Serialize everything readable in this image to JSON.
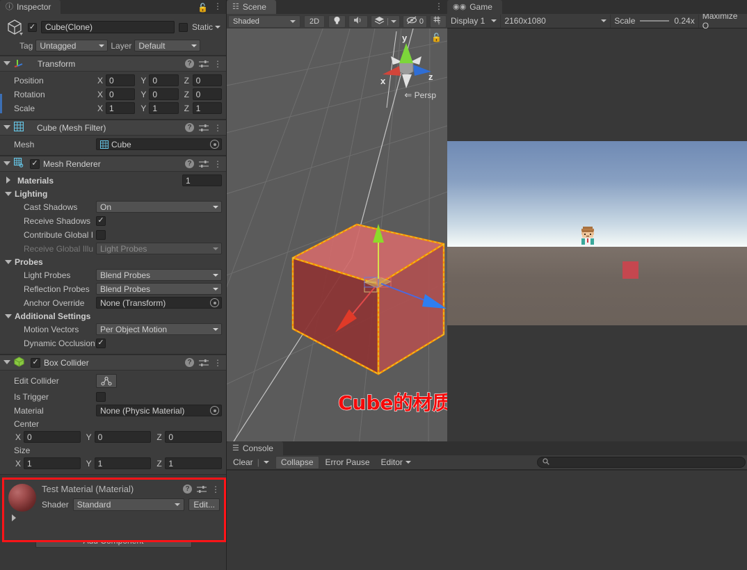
{
  "inspector": {
    "tab_label": "Inspector",
    "tab_icon": "info-icon",
    "lock_icon": "lock-icon",
    "menu_icon": "kebab-menu-icon",
    "object": {
      "enabled": true,
      "name": "Cube(Clone)",
      "static_label": "Static",
      "static_checked": false,
      "tag_label": "Tag",
      "tag_value": "Untagged",
      "layer_label": "Layer",
      "layer_value": "Default"
    },
    "components": [
      {
        "title": "Transform",
        "icon": "transform-axes-icon",
        "expanded": true,
        "rows": [
          {
            "label": "Position",
            "x": "0",
            "y": "0",
            "z": "0"
          },
          {
            "label": "Rotation",
            "x": "0",
            "y": "0",
            "z": "0"
          },
          {
            "label": "Scale",
            "x": "1",
            "y": "1",
            "z": "1"
          }
        ]
      },
      {
        "title": "Cube (Mesh Filter)",
        "icon": "mesh-filter-icon",
        "expanded": true,
        "mesh_label": "Mesh",
        "mesh_value": "Cube"
      },
      {
        "title": "Mesh Renderer",
        "icon": "mesh-renderer-icon",
        "expanded": true,
        "enabled": true,
        "materials_label": "Materials",
        "materials_count": "1",
        "lighting_label": "Lighting",
        "cast_shadows_label": "Cast Shadows",
        "cast_shadows_value": "On",
        "receive_shadows_label": "Receive Shadows",
        "receive_shadows_checked": true,
        "contribute_gi_label": "Contribute Global I",
        "contribute_gi_checked": false,
        "receive_gi_label": "Receive Global Illu",
        "receive_gi_value": "Light Probes",
        "probes_label": "Probes",
        "light_probes_label": "Light Probes",
        "light_probes_value": "Blend Probes",
        "reflection_probes_label": "Reflection Probes",
        "reflection_probes_value": "Blend Probes",
        "anchor_override_label": "Anchor Override",
        "anchor_override_value": "None (Transform)",
        "additional_settings_label": "Additional Settings",
        "motion_vectors_label": "Motion Vectors",
        "motion_vectors_value": "Per Object Motion",
        "dynamic_occlusion_label": "Dynamic Occlusion",
        "dynamic_occlusion_checked": true
      },
      {
        "title": "Box Collider",
        "icon": "box-collider-icon",
        "expanded": true,
        "enabled": true,
        "edit_collider_label": "Edit Collider",
        "is_trigger_label": "Is Trigger",
        "is_trigger_checked": false,
        "material_label": "Material",
        "material_value": "None (Physic Material)",
        "center_label": "Center",
        "center": {
          "x": "0",
          "y": "0",
          "z": "0"
        },
        "size_label": "Size",
        "size": {
          "x": "1",
          "y": "1",
          "z": "1"
        }
      }
    ],
    "material_block": {
      "title": "Test Material (Material)",
      "shader_label": "Shader",
      "shader_value": "Standard",
      "edit_label": "Edit...",
      "highlight_color": "#ff1418",
      "sphere_color": "#9d4b4b"
    },
    "add_component_label": "Add Component"
  },
  "scene": {
    "tab_label": "Scene",
    "tab_icon": "grid-icon",
    "toolbar": {
      "shading_mode": "Shaded",
      "mode_2d": "2D",
      "lighting_icon": "lightbulb-icon",
      "audio_icon": "speaker-icon",
      "fx_icon": "effects-icon",
      "hidden_objects_icon": "eye-off-icon",
      "hidden_objects_count": "0",
      "grid_icon": "grid-visibility-icon"
    },
    "gizmo": {
      "x_label": "x",
      "y_label": "y",
      "z_label": "z",
      "projection_label": "Persp",
      "x_color": "#d2453a",
      "y_color": "#7cd63a",
      "z_color": "#2f6ed6"
    },
    "overlay_text": "Cube的材质球正常显示",
    "overlay_color": "#f50a0a",
    "selection_outline_color": "#ff8c00"
  },
  "game": {
    "tab_label": "Game",
    "tab_icon": "gamepad-icon",
    "toolbar": {
      "display_label": "Display 1",
      "resolution_label": "2160x1080",
      "scale_label": "Scale",
      "scale_value": "0.24x",
      "maximize_label": "Maximize O"
    }
  },
  "console": {
    "tab_label": "Console",
    "tab_icon": "console-icon",
    "toolbar": {
      "clear_label": "Clear",
      "collapse_label": "Collapse",
      "error_pause_label": "Error Pause",
      "editor_label": "Editor",
      "search_placeholder": ""
    }
  }
}
